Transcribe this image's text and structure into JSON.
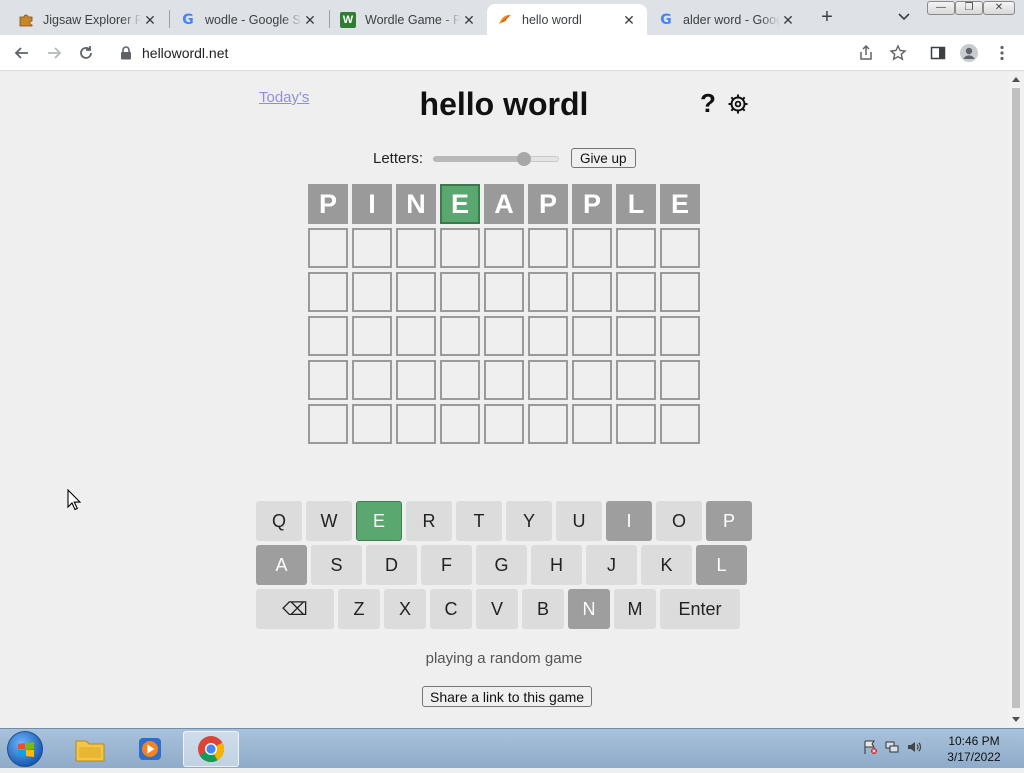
{
  "browser": {
    "tabs": [
      {
        "title": "Jigsaw Explorer Pu",
        "icon": "jigsaw-icon",
        "active": false
      },
      {
        "title": "wodle - Google S",
        "icon": "google-icon",
        "active": false
      },
      {
        "title": "Wordle Game - Pl",
        "icon": "wordle-game-icon",
        "active": false
      },
      {
        "title": "hello wordl",
        "icon": "hello-wordl-icon",
        "active": true
      },
      {
        "title": "alder word - Goog",
        "icon": "google-icon",
        "active": false
      }
    ],
    "url": "hellowordl.net"
  },
  "page": {
    "todays_link": "Today's",
    "title": "hello wordl",
    "help_label": "?",
    "letters_label": "Letters:",
    "letters_slider_fraction": 0.72,
    "give_up_label": "Give up",
    "board": [
      [
        [
          "P",
          "absent"
        ],
        [
          "I",
          "absent"
        ],
        [
          "N",
          "absent"
        ],
        [
          "E",
          "correct"
        ],
        [
          "A",
          "absent"
        ],
        [
          "P",
          "absent"
        ],
        [
          "P",
          "absent"
        ],
        [
          "L",
          "absent"
        ],
        [
          "E",
          "absent"
        ]
      ],
      [
        [
          "",
          "empty"
        ],
        [
          "",
          "empty"
        ],
        [
          "",
          "empty"
        ],
        [
          "",
          "empty"
        ],
        [
          "",
          "empty"
        ],
        [
          "",
          "empty"
        ],
        [
          "",
          "empty"
        ],
        [
          "",
          "empty"
        ],
        [
          "",
          "empty"
        ]
      ],
      [
        [
          "",
          "empty"
        ],
        [
          "",
          "empty"
        ],
        [
          "",
          "empty"
        ],
        [
          "",
          "empty"
        ],
        [
          "",
          "empty"
        ],
        [
          "",
          "empty"
        ],
        [
          "",
          "empty"
        ],
        [
          "",
          "empty"
        ],
        [
          "",
          "empty"
        ]
      ],
      [
        [
          "",
          "empty"
        ],
        [
          "",
          "empty"
        ],
        [
          "",
          "empty"
        ],
        [
          "",
          "empty"
        ],
        [
          "",
          "empty"
        ],
        [
          "",
          "empty"
        ],
        [
          "",
          "empty"
        ],
        [
          "",
          "empty"
        ],
        [
          "",
          "empty"
        ]
      ],
      [
        [
          "",
          "empty"
        ],
        [
          "",
          "empty"
        ],
        [
          "",
          "empty"
        ],
        [
          "",
          "empty"
        ],
        [
          "",
          "empty"
        ],
        [
          "",
          "empty"
        ],
        [
          "",
          "empty"
        ],
        [
          "",
          "empty"
        ],
        [
          "",
          "empty"
        ]
      ],
      [
        [
          "",
          "empty"
        ],
        [
          "",
          "empty"
        ],
        [
          "",
          "empty"
        ],
        [
          "",
          "empty"
        ],
        [
          "",
          "empty"
        ],
        [
          "",
          "empty"
        ],
        [
          "",
          "empty"
        ],
        [
          "",
          "empty"
        ],
        [
          "",
          "empty"
        ]
      ]
    ],
    "keyboard": [
      [
        [
          "Q",
          ""
        ],
        [
          "W",
          ""
        ],
        [
          "E",
          "correct"
        ],
        [
          "R",
          ""
        ],
        [
          "T",
          ""
        ],
        [
          "Y",
          ""
        ],
        [
          "U",
          ""
        ],
        [
          "I",
          "absent"
        ],
        [
          "O",
          ""
        ],
        [
          "P",
          "absent"
        ]
      ],
      [
        [
          "A",
          "absent"
        ],
        [
          "S",
          ""
        ],
        [
          "D",
          ""
        ],
        [
          "F",
          ""
        ],
        [
          "G",
          ""
        ],
        [
          "H",
          ""
        ],
        [
          "J",
          ""
        ],
        [
          "K",
          ""
        ],
        [
          "L",
          "absent"
        ]
      ],
      [
        [
          "⌫",
          ""
        ],
        [
          "Z",
          ""
        ],
        [
          "X",
          ""
        ],
        [
          "C",
          ""
        ],
        [
          "V",
          ""
        ],
        [
          "B",
          ""
        ],
        [
          "N",
          "absent"
        ],
        [
          "M",
          ""
        ],
        [
          "Enter",
          ""
        ]
      ]
    ],
    "status": "playing a random game",
    "share_label": "Share a link to this game"
  },
  "taskbar": {
    "apps": [
      "file-explorer-icon",
      "media-player-icon",
      "chrome-icon"
    ],
    "time": "10:46 PM",
    "date": "3/17/2022"
  },
  "colors": {
    "correct": "#5aa86f",
    "absent": "#9a9a9a",
    "background": "#efefef"
  }
}
